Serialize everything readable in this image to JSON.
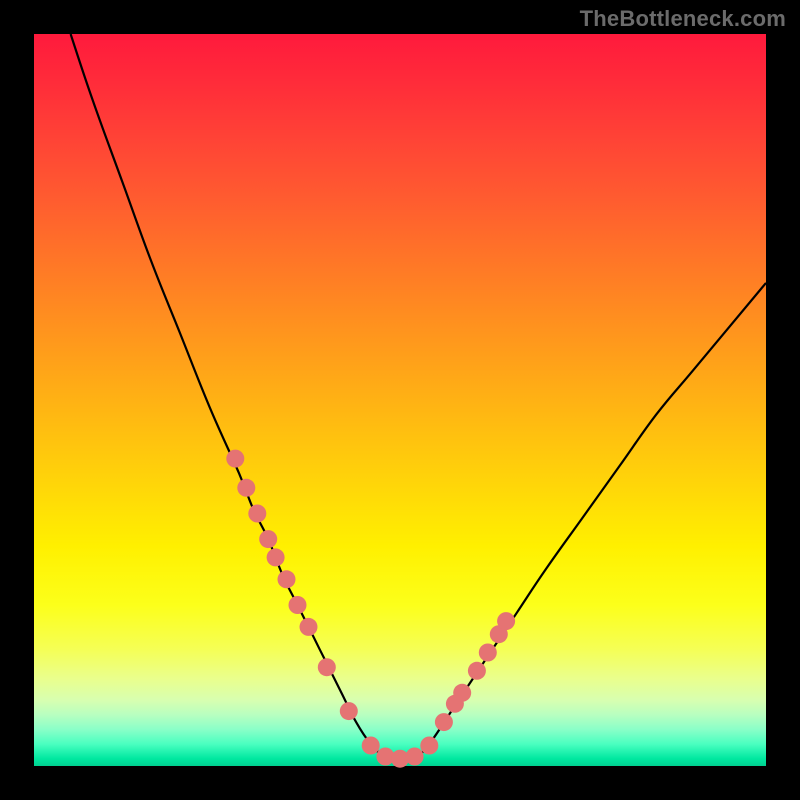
{
  "watermark": {
    "text": "TheBottleneck.com"
  },
  "colors": {
    "curve": "#000000",
    "marker_fill": "#e57373",
    "marker_stroke": "#c05a5a",
    "band_top": "#ff1a3c",
    "band_bottom": "#00d090"
  },
  "chart_data": {
    "type": "line",
    "title": "",
    "xlabel": "",
    "ylabel": "",
    "xlim": [
      0,
      100
    ],
    "ylim": [
      0,
      100
    ],
    "grid": false,
    "legend": false,
    "note": "Values estimated from pixel positions; axes are implicit (0–100).",
    "series": [
      {
        "name": "bottleneck-curve",
        "x": [
          5,
          8,
          12,
          16,
          20,
          24,
          28,
          30,
          32,
          34,
          36,
          38,
          40,
          42,
          44,
          46,
          48,
          50,
          52,
          54,
          58,
          62,
          66,
          70,
          75,
          80,
          85,
          90,
          95,
          100
        ],
        "y": [
          100,
          91,
          80,
          69,
          59,
          49,
          40,
          35,
          31,
          26,
          22,
          18,
          14,
          10,
          6,
          3,
          1.2,
          0.8,
          1.2,
          3,
          9,
          15,
          21,
          27,
          34,
          41,
          48,
          54,
          60,
          66
        ]
      }
    ],
    "markers": {
      "name": "highlight-points",
      "x": [
        27.5,
        29.0,
        30.5,
        32.0,
        33.0,
        34.5,
        36.0,
        37.5,
        40.0,
        43.0,
        46.0,
        48.0,
        50.0,
        52.0,
        54.0,
        56.0,
        57.5,
        58.5,
        60.5,
        62.0,
        63.5,
        64.5
      ],
      "y": [
        42.0,
        38.0,
        34.5,
        31.0,
        28.5,
        25.5,
        22.0,
        19.0,
        13.5,
        7.5,
        2.8,
        1.3,
        1.0,
        1.3,
        2.8,
        6.0,
        8.5,
        10.0,
        13.0,
        15.5,
        18.0,
        19.8
      ]
    }
  }
}
